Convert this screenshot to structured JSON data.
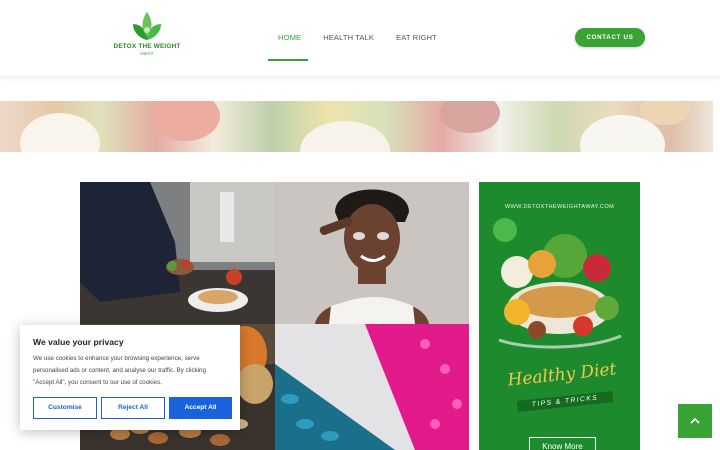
{
  "header": {
    "logo": {
      "title": "DETOX THE WEIGHT",
      "subtitle": "AWAY"
    },
    "nav": [
      {
        "label": "HOME",
        "active": true
      },
      {
        "label": "HEALTH TALK",
        "active": false
      },
      {
        "label": "EAT RIGHT",
        "active": false
      }
    ],
    "contact_label": "CONTACT US"
  },
  "colors": {
    "brand_green": "#3aa335",
    "ad_green": "#1e8a2e",
    "cookie_blue": "#1863dc",
    "ad_title_yellow": "#f2c94c"
  },
  "ad": {
    "url": "WWW.DETOXTHEWEIGHTAWAY.COM",
    "title": "Healthy Diet",
    "ribbon": "TIPS & TRICKS",
    "button": "Know More"
  },
  "cookie": {
    "title": "We value your privacy",
    "text": "We use cookies to enhance your browsing experience, serve personalised ads or content, and analyse our traffic. By clicking \"Accept All\", you consent to our use of cookies.",
    "customise": "Customise",
    "reject": "Reject All",
    "accept": "Accept All"
  },
  "icons": {
    "back_to_top": "chevron-up-icon",
    "logo": "leaf-icon"
  }
}
